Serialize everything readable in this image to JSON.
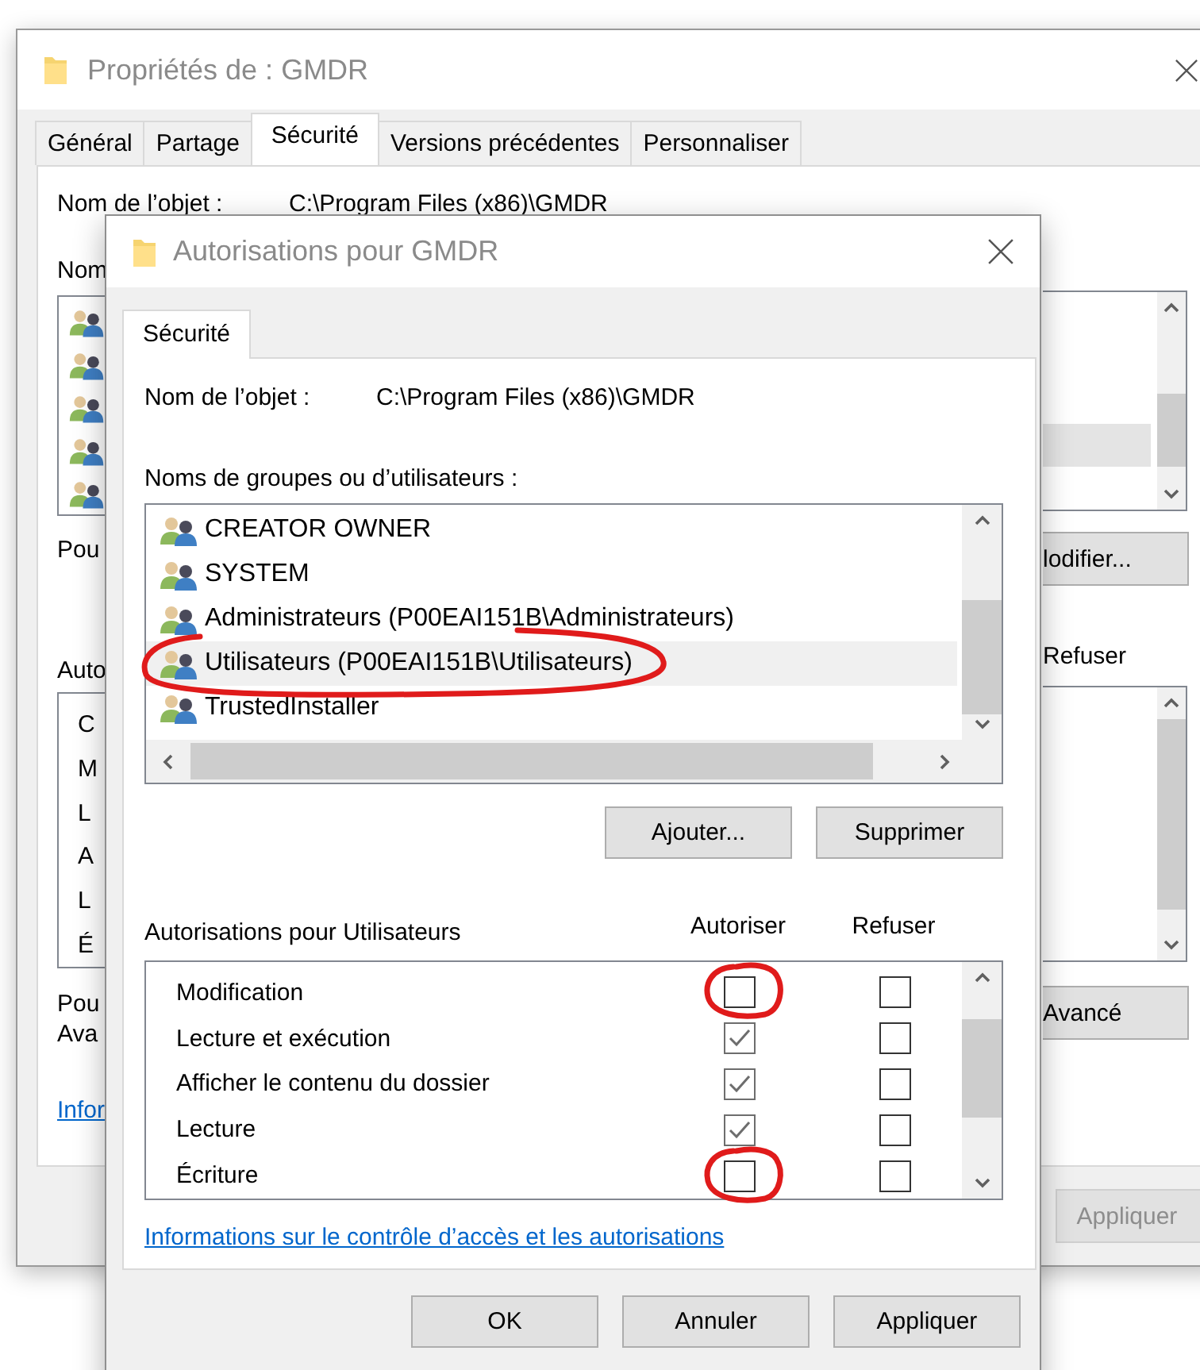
{
  "background_window": {
    "title": "Propriétés de : GMDR",
    "tabs": [
      {
        "label": "Général",
        "selected": false
      },
      {
        "label": "Partage",
        "selected": false
      },
      {
        "label": "Sécurité",
        "selected": true
      },
      {
        "label": "Versions précédentes",
        "selected": false
      },
      {
        "label": "Personnaliser",
        "selected": false
      }
    ],
    "object_label": "Nom de l’objet :",
    "object_path": "C:\\Program Files (x86)\\GMDR",
    "groups_label": "Nom",
    "groups": [
      {
        "selected": false
      },
      {
        "selected": false
      },
      {
        "selected": false
      },
      {
        "selected": true
      },
      {
        "selected": false
      }
    ],
    "edit_hint": "Pou",
    "edit_button": "lodifier...",
    "permissions_label": "Auto",
    "deny_header": "Refuser",
    "permission_initials": [
      "C",
      "M",
      "L",
      "A",
      "L",
      "É"
    ],
    "advanced_hint": [
      "Pou",
      "Ava"
    ],
    "advanced_button": "Avancé",
    "link": "Infor",
    "apply_button": {
      "label": "Appliquer",
      "disabled": true
    }
  },
  "dialog": {
    "title": "Autorisations pour GMDR",
    "tab": {
      "label": "Sécurité",
      "selected": true
    },
    "object_label": "Nom de l’objet :",
    "object_path": "C:\\Program Files (x86)\\GMDR",
    "groups_label": "Noms de groupes ou d’utilisateurs :",
    "users": [
      {
        "name": "CREATOR OWNER",
        "selected": false,
        "circled": false
      },
      {
        "name": "SYSTEM",
        "selected": false,
        "circled": false
      },
      {
        "name": "Administrateurs (P00EAI151B\\Administrateurs)",
        "selected": false,
        "circled": false
      },
      {
        "name": "Utilisateurs (P00EAI151B\\Utilisateurs)",
        "selected": true,
        "circled": true
      },
      {
        "name": "TrustedInstaller",
        "selected": false,
        "circled": false
      }
    ],
    "add_button": "Ajouter...",
    "remove_button": "Supprimer",
    "permissions_label": "Autorisations pour Utilisateurs",
    "allow_header": "Autoriser",
    "deny_header": "Refuser",
    "permissions": [
      {
        "name": "Modification",
        "allow": false,
        "deny": false,
        "allow_circled": true
      },
      {
        "name": "Lecture et exécution",
        "allow": true,
        "deny": false,
        "allow_circled": false
      },
      {
        "name": "Afficher le contenu du dossier",
        "allow": true,
        "deny": false,
        "allow_circled": false
      },
      {
        "name": "Lecture",
        "allow": true,
        "deny": false,
        "allow_circled": false
      },
      {
        "name": "Écriture",
        "allow": false,
        "deny": false,
        "allow_circled": true
      }
    ],
    "link": "Informations sur le contrôle d’accès et les autorisations",
    "footer_buttons": [
      "OK",
      "Annuler",
      "Appliquer"
    ]
  }
}
